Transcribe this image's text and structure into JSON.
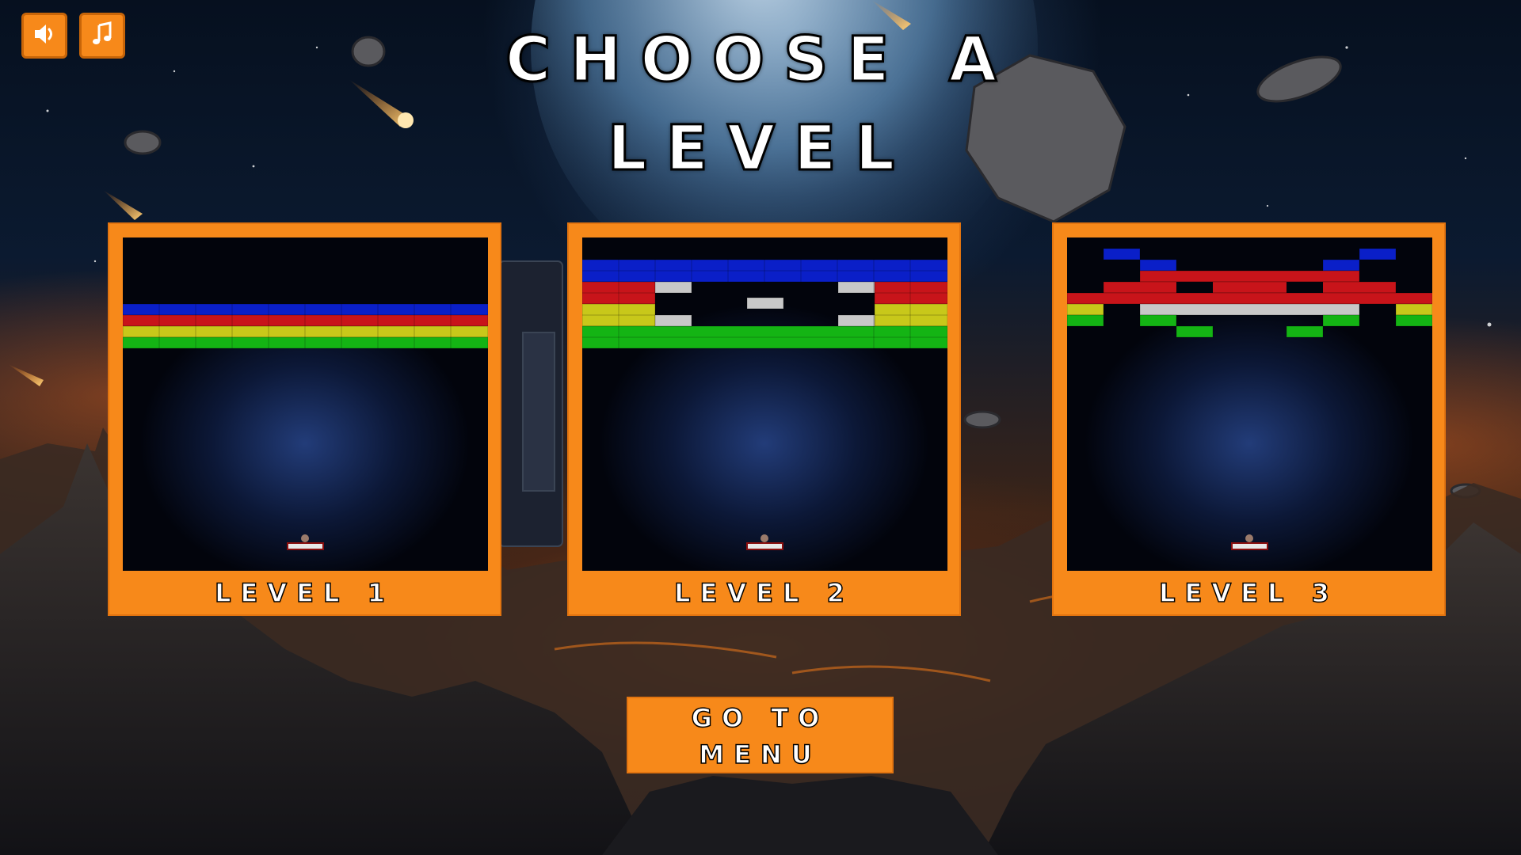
{
  "screen": {
    "title": "CHOOSE A LEVEL"
  },
  "toolbar": {
    "sound_icon": "speaker-icon",
    "music_icon": "music-note-icon"
  },
  "levels": [
    {
      "label": "LEVEL 1"
    },
    {
      "label": "LEVEL 2"
    },
    {
      "label": "LEVEL 3"
    }
  ],
  "menu_button": {
    "label": "GO TO MENU"
  },
  "colors": {
    "accent": "#f7891a",
    "brick_blue": "#0a1fc8",
    "brick_red": "#c8141a",
    "brick_yellow": "#c8c81a",
    "brick_green": "#14b414",
    "brick_silver": "#c8c8c8"
  }
}
